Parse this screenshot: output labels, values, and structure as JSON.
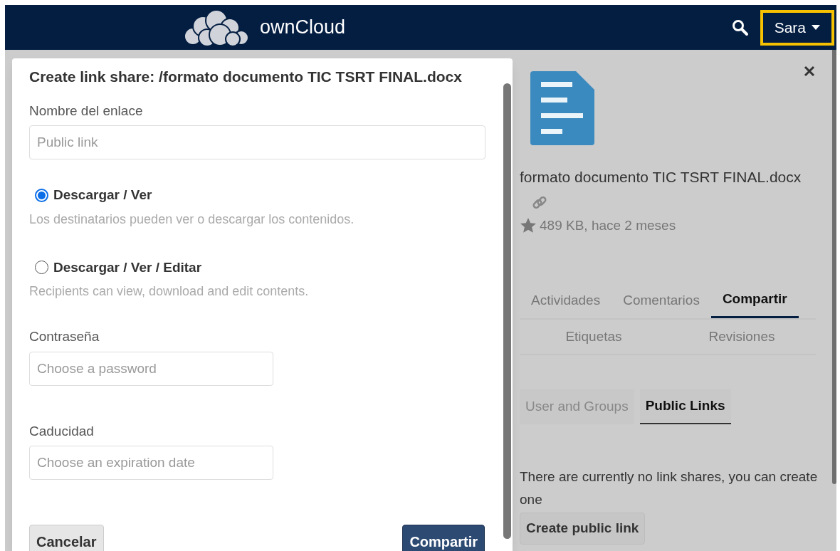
{
  "header": {
    "logo_text": "ownCloud",
    "user": "Sara"
  },
  "dialog": {
    "title": "Create link share: /formato documento TIC TSRT FINAL.docx",
    "link_name": {
      "label": "Nombre del enlace",
      "placeholder": "Public link"
    },
    "permissions": [
      {
        "label": "Descargar / Ver",
        "description": "Los destinatarios pueden ver o descargar los contenidos.",
        "selected": true
      },
      {
        "label": "Descargar / Ver / Editar",
        "description": "Recipients can view, download and edit contents.",
        "selected": false
      }
    ],
    "password": {
      "label": "Contraseña",
      "placeholder": "Choose a password"
    },
    "expiration": {
      "label": "Caducidad",
      "placeholder": "Choose an expiration date"
    },
    "buttons": [
      {
        "label": "Cancelar",
        "kind": "secondary"
      },
      {
        "label": "Compartir",
        "kind": "primary"
      }
    ]
  },
  "details": {
    "file_name": "formato documento TIC TSRT FINAL.docx",
    "meta": "489 KB, hace 2 meses",
    "tabs": [
      {
        "label": "Actividades",
        "selected": false
      },
      {
        "label": "Comentarios",
        "selected": false
      },
      {
        "label": "Compartir",
        "selected": true
      },
      {
        "label": "Etiquetas",
        "selected": false
      },
      {
        "label": "Revisiones",
        "selected": false
      }
    ],
    "share_tabs": [
      {
        "label": "User and Groups",
        "selected": false
      },
      {
        "label": "Public Links",
        "selected": true
      }
    ],
    "empty_message": "There are currently no link shares, you can create one",
    "create_button": "Create public link"
  }
}
